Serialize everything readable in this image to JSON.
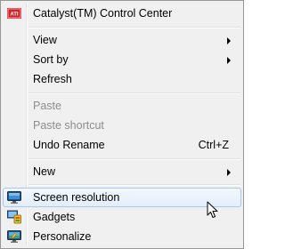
{
  "menu": {
    "items": [
      {
        "label": "Catalyst(TM) Control Center",
        "icon": "ati-logo-icon"
      },
      {
        "label": "View",
        "submenu": true
      },
      {
        "label": "Sort by",
        "submenu": true
      },
      {
        "label": "Refresh"
      },
      {
        "label": "Paste",
        "disabled": true
      },
      {
        "label": "Paste shortcut",
        "disabled": true
      },
      {
        "label": "Undo Rename",
        "shortcut": "Ctrl+Z"
      },
      {
        "label": "New",
        "submenu": true
      },
      {
        "label": "Screen resolution",
        "icon": "display-icon",
        "highlighted": true
      },
      {
        "label": "Gadgets",
        "icon": "gadgets-icon"
      },
      {
        "label": "Personalize",
        "icon": "personalize-icon"
      }
    ],
    "colors": {
      "background": "#f0f0f0",
      "border": "#979797",
      "highlight_border": "#a8c8ef",
      "disabled_text": "#8d8d8d",
      "ati_red": "#d31f26"
    }
  }
}
